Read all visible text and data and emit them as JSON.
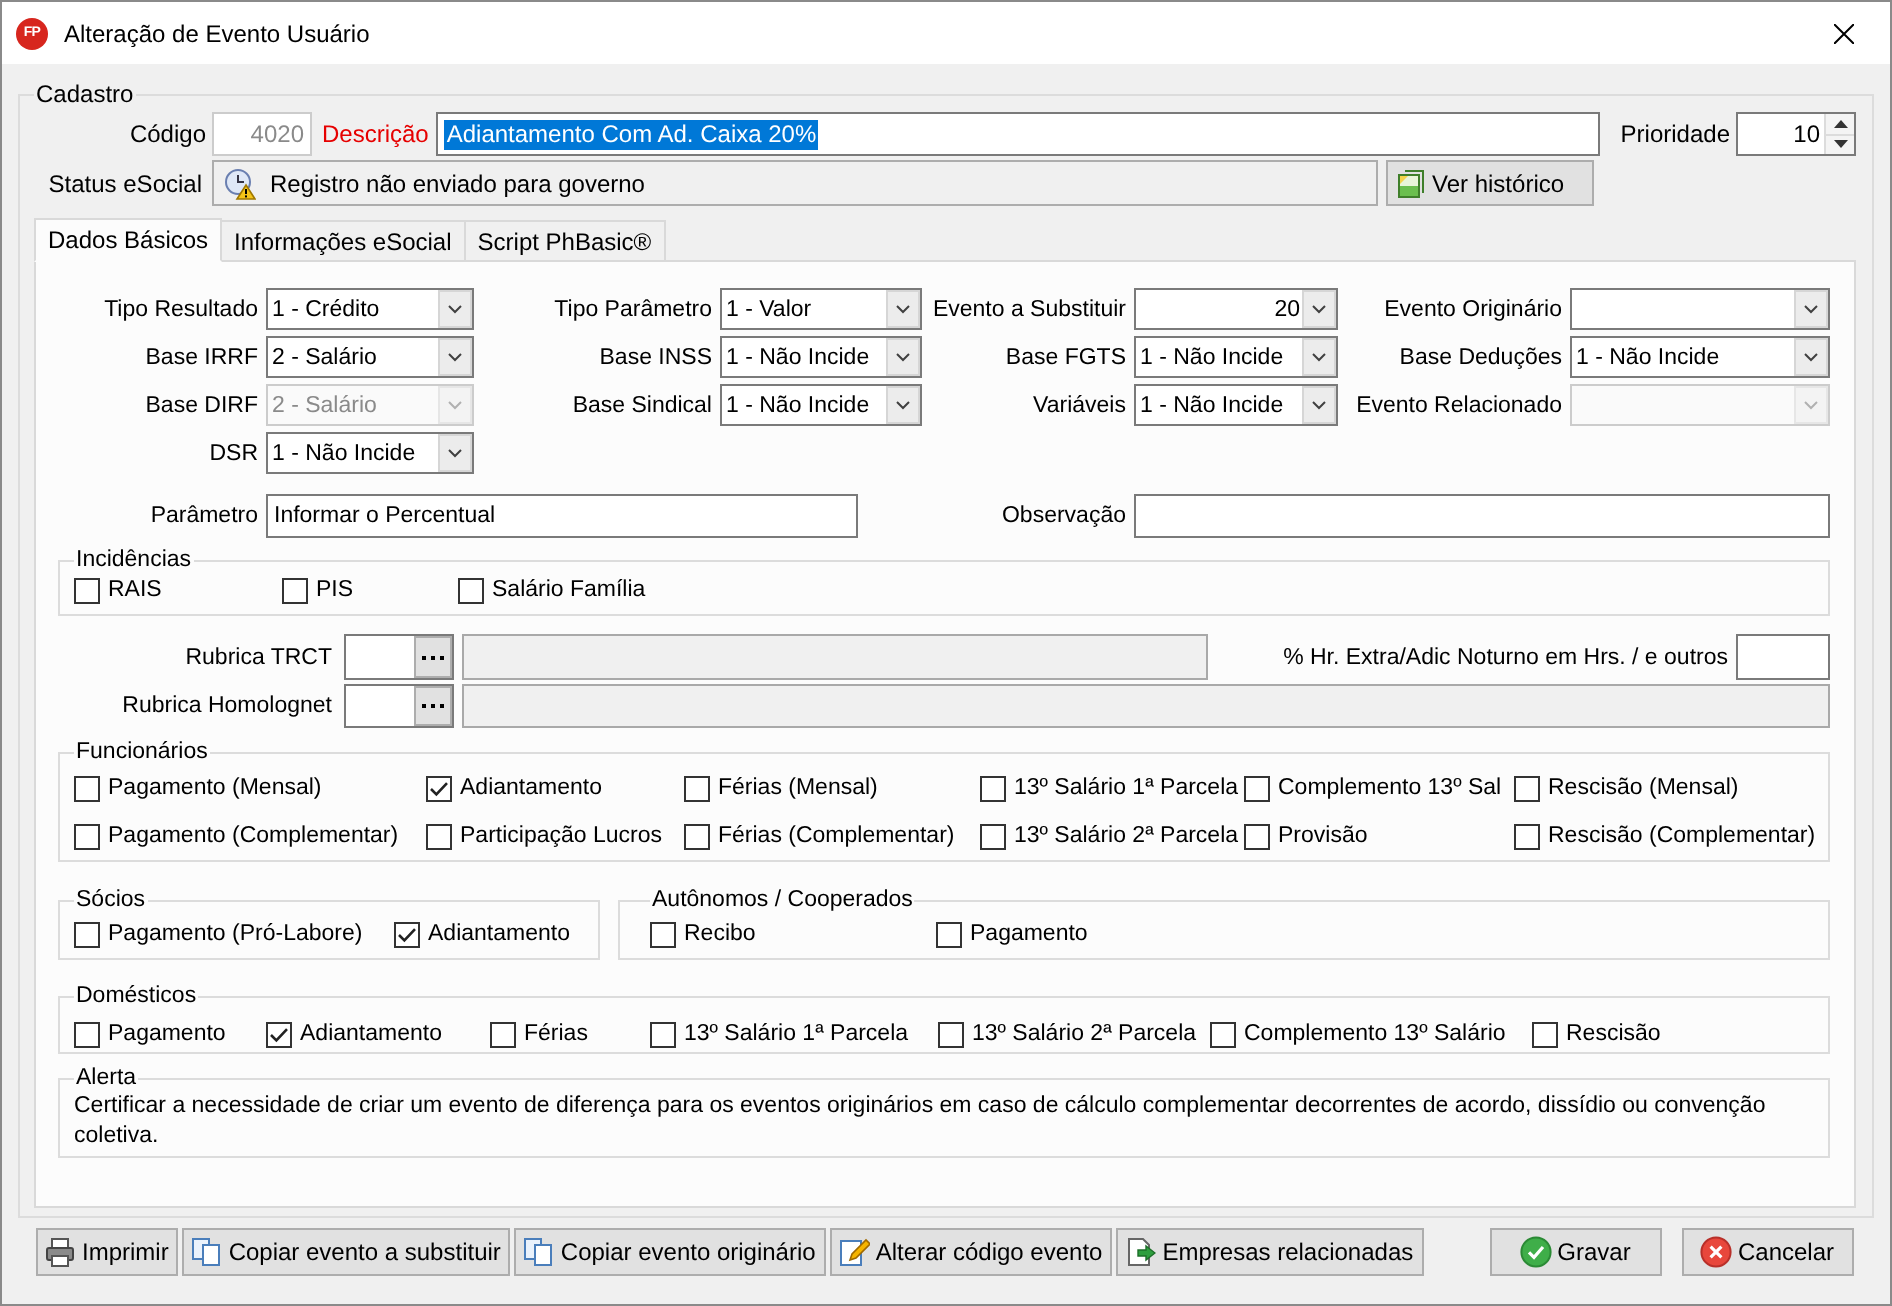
{
  "window": {
    "logo": "FP",
    "title": "Alteração de Evento Usuário"
  },
  "cadastro": {
    "title": "Cadastro",
    "codigo": {
      "label": "Código",
      "value": "4020",
      "disabled": true
    },
    "descricao": {
      "label": "Descrição",
      "value": "Adiantamento Com Ad. Caixa 20%",
      "required": true,
      "text_selected": true
    },
    "prioridade": {
      "label": "Prioridade",
      "value": "10"
    },
    "status_esocial": {
      "label": "Status eSocial",
      "value": "Registro não enviado para governo"
    },
    "history_button": {
      "label": "Ver histórico"
    }
  },
  "tabs": [
    {
      "label": "Dados Básicos",
      "selected": true
    },
    {
      "label": "Informações eSocial",
      "selected": false
    },
    {
      "label": "Script PhBasic®",
      "selected": false
    }
  ],
  "dados_basicos": {
    "field_rows": [
      [
        {
          "label": "Tipo Resultado",
          "value": "1 - Crédito",
          "kind": "select",
          "disabled": false
        },
        {
          "label": "Tipo Parâmetro",
          "value": "1 - Valor",
          "kind": "select",
          "disabled": false
        },
        {
          "label": "Evento a Substituir",
          "value": "20",
          "kind": "number",
          "disabled": false
        },
        {
          "label": "Evento Originário",
          "kind": "select",
          "disabled": false
        }
      ],
      [
        {
          "label": "Base IRRF",
          "value": "2 - Salário",
          "kind": "select",
          "disabled": false
        },
        {
          "label": "Base INSS",
          "value": "1 - Não Incide",
          "kind": "select",
          "disabled": false
        },
        {
          "label": "Base FGTS",
          "value": "1 - Não Incide",
          "kind": "select",
          "disabled": false
        },
        {
          "label": "Base Deduções",
          "value": "1 - Não Incide",
          "kind": "select",
          "disabled": false
        }
      ],
      [
        {
          "label": "Base DIRF",
          "value": "2 - Salário",
          "kind": "select",
          "disabled": true
        },
        {
          "label": "Base Sindical",
          "value": "1 - Não Incide",
          "kind": "select",
          "disabled": false
        },
        {
          "label": "Variáveis",
          "value": "1 - Não Incide",
          "kind": "select",
          "disabled": false
        },
        {
          "label": "Evento Relacionado",
          "kind": "select",
          "disabled": true
        }
      ],
      [
        {
          "label": "DSR",
          "value": "1 - Não Incide",
          "kind": "select",
          "disabled": false
        }
      ]
    ],
    "parametro": {
      "label": "Parâmetro",
      "value": "Informar o Percentual"
    },
    "observacao": {
      "label": "Observação"
    },
    "incidencias": {
      "title": "Incidências",
      "items": [
        {
          "label": "RAIS",
          "checked": false
        },
        {
          "label": "PIS",
          "checked": false
        },
        {
          "label": "Salário Família",
          "checked": false
        }
      ]
    },
    "rubrica_trct": {
      "label": "Rubrica TRCT"
    },
    "hr_extra": {
      "label": "% Hr. Extra/Adic Noturno em Hrs. / e outros"
    },
    "rubrica_homolognet": {
      "label": "Rubrica Homolognet"
    },
    "funcionarios": {
      "title": "Funcionários",
      "items": [
        {
          "label": "Pagamento (Mensal)",
          "checked": false
        },
        {
          "label": "Adiantamento",
          "checked": true
        },
        {
          "label": "Férias (Mensal)",
          "checked": false
        },
        {
          "label": "13º Salário 1ª Parcela",
          "checked": false
        },
        {
          "label": "Complemento 13º Sal",
          "checked": false
        },
        {
          "label": "Rescisão (Mensal)",
          "checked": false
        },
        {
          "label": "Pagamento (Complementar)",
          "checked": false
        },
        {
          "label": "Participação Lucros",
          "checked": false
        },
        {
          "label": "Férias (Complementar)",
          "checked": false
        },
        {
          "label": "13º Salário 2ª Parcela",
          "checked": false
        },
        {
          "label": "Provisão",
          "checked": false
        },
        {
          "label": "Rescisão (Complementar)",
          "checked": false
        }
      ]
    },
    "socios": {
      "title": "Sócios",
      "items": [
        {
          "label": "Pagamento (Pró-Labore)",
          "checked": false
        },
        {
          "label": "Adiantamento",
          "checked": true
        }
      ]
    },
    "autonomos": {
      "title": "Autônomos / Cooperados",
      "items": [
        {
          "label": "Recibo",
          "checked": false
        },
        {
          "label": "Pagamento",
          "checked": false
        }
      ]
    },
    "domesticos": {
      "title": "Domésticos",
      "items": [
        {
          "label": "Pagamento",
          "checked": false
        },
        {
          "label": "Adiantamento",
          "checked": true
        },
        {
          "label": "Férias",
          "checked": false
        },
        {
          "label": "13º Salário 1ª Parcela",
          "checked": false
        },
        {
          "label": "13º Salário 2ª Parcela",
          "checked": false
        },
        {
          "label": "Complemento 13º Salário",
          "checked": false
        },
        {
          "label": "Rescisão",
          "checked": false
        }
      ]
    },
    "alerta": {
      "title": "Alerta",
      "text": "Certificar a necessidade de criar um evento de diferença para os eventos originários em caso de cálculo complementar decorrentes de acordo, dissídio ou convenção coletiva."
    }
  },
  "actions": [
    {
      "label": "Imprimir",
      "kind": "print"
    },
    {
      "label": "Copiar evento a substituir",
      "kind": "copy"
    },
    {
      "label": "Copiar evento originário",
      "kind": "copy"
    },
    {
      "label": "Alterar código evento",
      "kind": "edit"
    },
    {
      "label": "Empresas relacionadas",
      "kind": "export"
    }
  ],
  "dialog_buttons": [
    {
      "label": "Gravar",
      "kind": "confirm"
    },
    {
      "label": "Cancelar",
      "kind": "cancel"
    }
  ]
}
